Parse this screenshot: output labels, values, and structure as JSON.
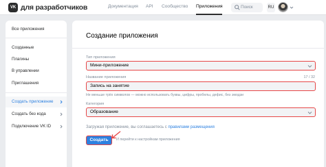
{
  "header": {
    "logo_badge": "VK",
    "logo_text": "для разработчиков",
    "nav": [
      "Документация",
      "API",
      "Сообщество",
      "Приложения"
    ],
    "active_nav": "Приложения",
    "search_label": "Поиск",
    "lang": "RU"
  },
  "sidebar": {
    "items": [
      {
        "label": "Все приложения"
      },
      {
        "label": "Созданные"
      },
      {
        "label": "Плагины"
      },
      {
        "label": "В управлении"
      },
      {
        "label": "Приглашения"
      },
      {
        "label": "Создать приложение",
        "active": true
      },
      {
        "label": "Создать без кода"
      },
      {
        "label": "Подключение VK ID"
      }
    ]
  },
  "form": {
    "title": "Создание приложения",
    "type_label": "Тип приложения",
    "type_value": "Мини-приложение",
    "name_label": "Название приложения",
    "name_value": "Запись на занятие",
    "name_counter": "17 / 32",
    "name_hint": "Не меньше трёх символов — можно использовать буквы, цифры, пробелы, дефис, без эмодзи",
    "category_label": "Категория",
    "category_value": "Образование",
    "agree_text": "Загружая приложение, вы соглашаетесь с ",
    "agree_link": "правилами размещения",
    "create_button": "Создать",
    "redirect_note": "И перейти к настройкам приложения"
  },
  "colors": {
    "accent": "#2d81e0",
    "highlight_border": "#e64646",
    "background": "#eaecef"
  }
}
